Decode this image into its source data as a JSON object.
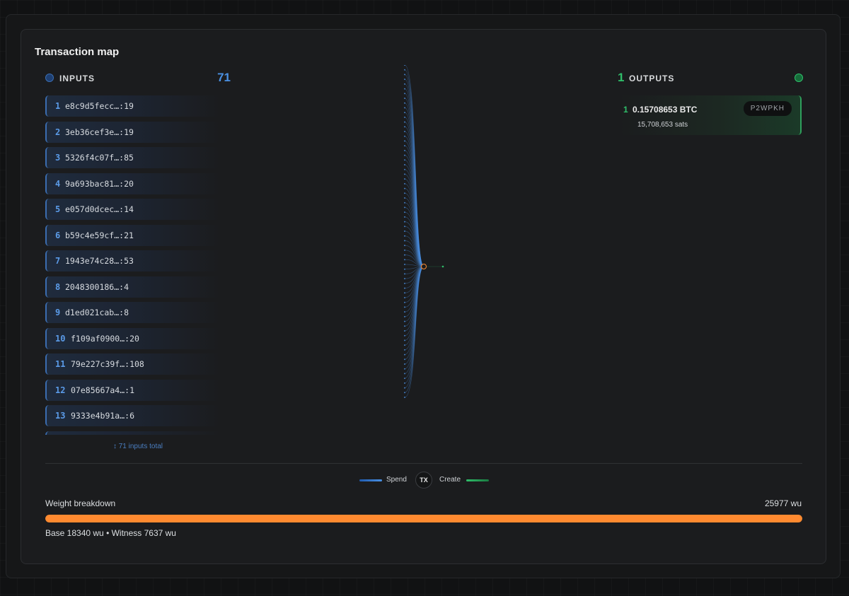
{
  "title": "Transaction map",
  "inputs": {
    "label": "INPUTS",
    "count": "71",
    "items": [
      {
        "num": "1",
        "id": "e8c9d5fecc…:19"
      },
      {
        "num": "2",
        "id": "3eb36cef3e…:19"
      },
      {
        "num": "3",
        "id": "5326f4c07f…:85"
      },
      {
        "num": "4",
        "id": "9a693bac81…:20"
      },
      {
        "num": "5",
        "id": "e057d0dcec…:14"
      },
      {
        "num": "6",
        "id": "b59c4e59cf…:21"
      },
      {
        "num": "7",
        "id": "1943e74c28…:53"
      },
      {
        "num": "8",
        "id": "2048300186…:4"
      },
      {
        "num": "9",
        "id": "d1ed021cab…:8"
      },
      {
        "num": "10",
        "id": "f109af0900…:20"
      },
      {
        "num": "11",
        "id": "79e227c39f…:108"
      },
      {
        "num": "12",
        "id": "07e85667a4…:1"
      },
      {
        "num": "13",
        "id": "9333e4b91a…:6"
      }
    ],
    "footer": "↕ 71 inputs total"
  },
  "outputs": {
    "label": "OUTPUTS",
    "count": "1",
    "items": [
      {
        "num": "1",
        "amount": "0.15708653 BTC",
        "sats": "15,708,653 sats",
        "type": "P2WPKH"
      }
    ]
  },
  "legend": {
    "spend": "Spend",
    "tx": "TX",
    "create": "Create"
  },
  "weight": {
    "label": "Weight breakdown",
    "total": "25977 wu",
    "detail": "Base 18340 wu • Witness 7637 wu",
    "fill_percent": 100
  },
  "colors": {
    "input_accent": "#4a90e2",
    "output_accent": "#2fbf6a",
    "weight_bar": "#ff8a30"
  }
}
